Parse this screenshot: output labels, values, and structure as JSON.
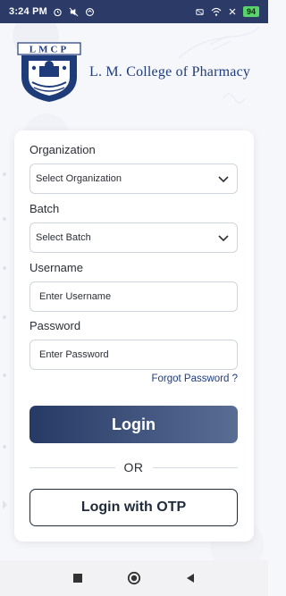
{
  "status_bar": {
    "time": "3:24 PM",
    "battery": "94"
  },
  "header": {
    "logo_letters": "LMCP",
    "college_name": "L. M. College of Pharmacy"
  },
  "form": {
    "organization": {
      "label": "Organization",
      "selected": "Select Organization"
    },
    "batch": {
      "label": "Batch",
      "selected": "Select Batch"
    },
    "username": {
      "label": "Username",
      "placeholder": "Enter Username"
    },
    "password": {
      "label": "Password",
      "placeholder": "Enter Password"
    },
    "forgot_password": "Forgot Password ?",
    "login_button": "Login",
    "or_text": "OR",
    "otp_button": "Login with OTP"
  },
  "colors": {
    "status_bar": "#2b3a67",
    "brand": "#1f3c7a",
    "button_gradient_start": "#263a66",
    "button_gradient_end": "#5a6d94"
  },
  "icons": {
    "status": [
      "alarm-icon",
      "mute-icon",
      "sync-icon",
      "wifi-icon",
      "battery-icon"
    ],
    "nav": [
      "recents-square-icon",
      "home-circle-icon",
      "back-triangle-icon"
    ]
  }
}
